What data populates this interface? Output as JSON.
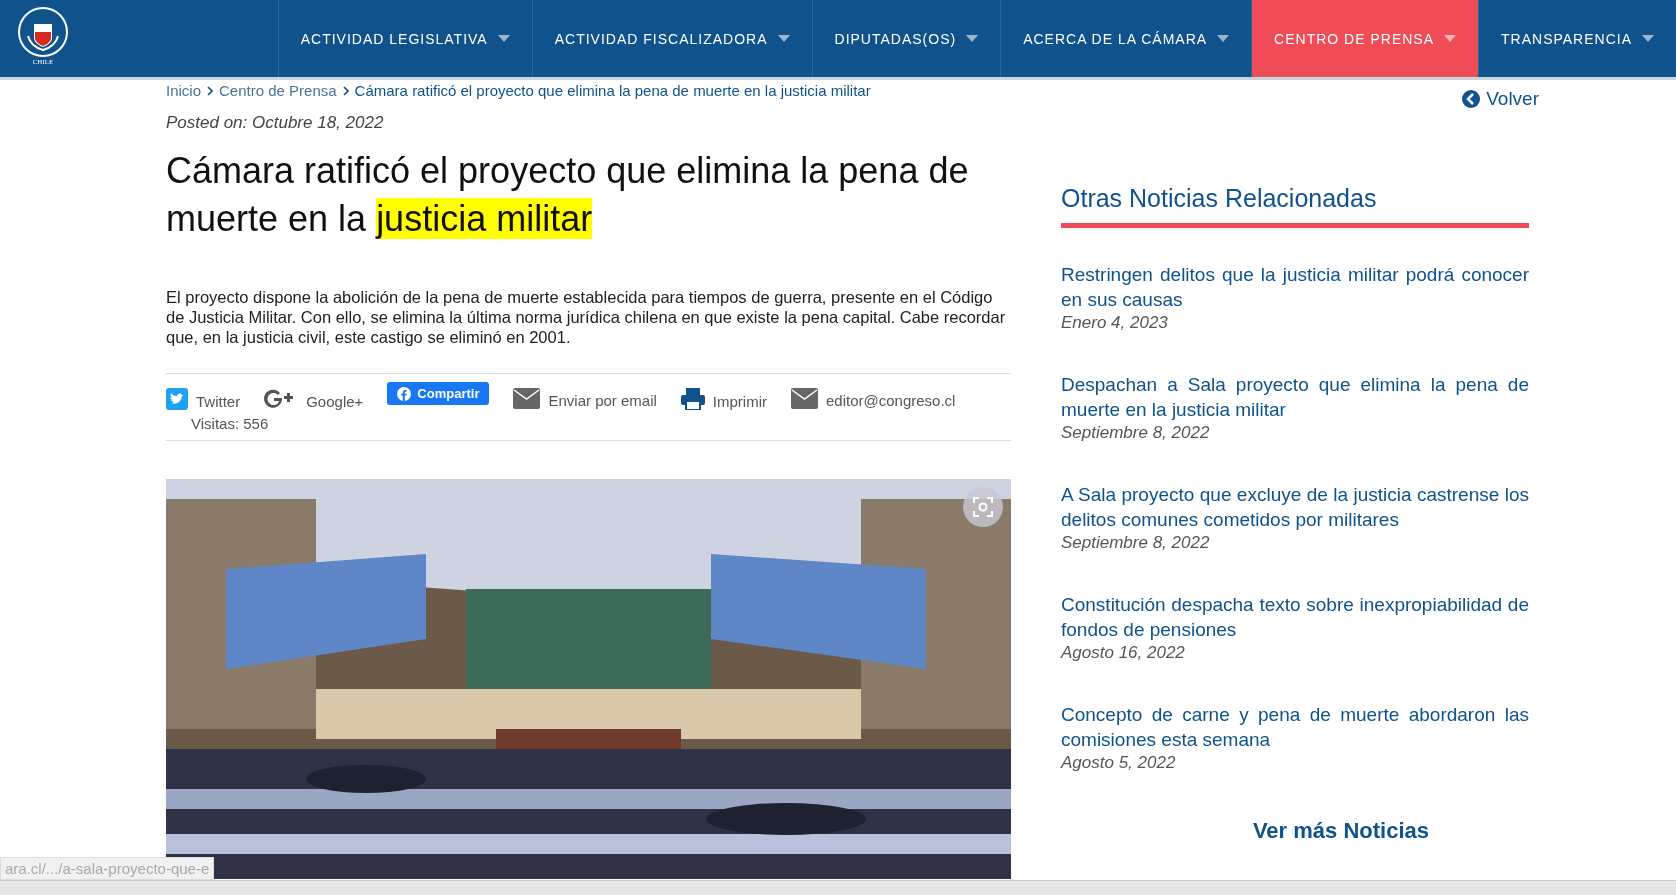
{
  "nav": {
    "logo_text": "CHILE",
    "items": [
      {
        "label": "ACTIVIDAD LEGISLATIVA",
        "selected": false
      },
      {
        "label": "ACTIVIDAD FISCALIZADORA",
        "selected": false
      },
      {
        "label": "DIPUTADAS(OS)",
        "selected": false
      },
      {
        "label": "ACERCA DE LA CÁMARA",
        "selected": false
      },
      {
        "label": "CENTRO DE PRENSA",
        "selected": true
      },
      {
        "label": "TRANSPARENCIA",
        "selected": false
      }
    ]
  },
  "breadcrumb": [
    "Inicio",
    "Centro de Prensa",
    "Cámara ratificó el proyecto que elimina la pena de muerte en la justicia militar"
  ],
  "back_link": "Volver",
  "posted": "Posted on: Octubre 18, 2022",
  "article": {
    "title_start": "Cámara ratificó el proyecto que elimina la pena de muerte en la",
    "title_highlight": "justicia militar",
    "lede": "El proyecto dispone la abolición de la pena de muerte establecida para tiempos de guerra, presente en el Código de Justicia Militar. Con ello, se elimina la última norma jurídica chilena en que existe la pena capital. Cabe recordar que, en la justicia civil, este castigo se eliminó en 2001.",
    "share": [
      {
        "kind": "twitter",
        "label": "Twitter"
      },
      {
        "kind": "google",
        "label": "Google+"
      },
      {
        "kind": "facebook",
        "label": "Compartir"
      },
      {
        "kind": "email",
        "label": "Enviar por email"
      },
      {
        "kind": "print",
        "label": "Imprimir"
      },
      {
        "kind": "email",
        "label": "editor@congreso.cl"
      }
    ],
    "visits": "Visitas: 556"
  },
  "sidebar": {
    "heading": "Otras Noticias Relacionadas",
    "items": [
      {
        "title": "Restringen delitos que la justicia militar podrá conocer en sus causas",
        "date": "Enero 4, 2023"
      },
      {
        "title": "Despachan a Sala proyecto que elimina la pena de muerte en la justicia militar",
        "date": "Septiembre 8, 2022"
      },
      {
        "title": "A Sala proyecto que excluye de la justicia castrense los delitos comunes cometidos por militares",
        "date": "Septiembre 8, 2022"
      },
      {
        "title": "Constitución despacha  texto sobre inexpropiabilidad de fondos de pensiones",
        "date": "Agosto 16, 2022"
      },
      {
        "title": "Concepto de carne y pena de muerte abordaron las comisiones esta semana",
        "date": "Agosto 5, 2022"
      }
    ],
    "more": "Ver más Noticias"
  },
  "status_url": "ara.cl/.../a-sala-proyecto-que-e"
}
